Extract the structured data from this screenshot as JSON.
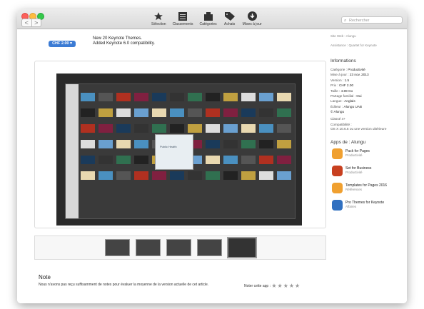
{
  "toolbar": {
    "nav_back": "<",
    "nav_forward": ">",
    "items": [
      {
        "label": "Sélection",
        "icon": "star-icon"
      },
      {
        "label": "Classements",
        "icon": "list-icon"
      },
      {
        "label": "Catégories",
        "icon": "box-icon"
      },
      {
        "label": "Achats",
        "icon": "tag-icon"
      },
      {
        "label": "Mises à jour",
        "icon": "download-icon"
      }
    ],
    "search_placeholder": "Rechercher"
  },
  "header": {
    "price": "CHF 2.00",
    "release_notes": [
      "New 20 Keynote Themes.",
      "Added Keynote 6.0 compatibility."
    ]
  },
  "sidebar": {
    "links": [
      "Site Web : Alungu",
      "Assistance : Quartet for Keynote"
    ],
    "informations_title": "Informations",
    "info": [
      {
        "label": "Catégorie :",
        "value": "Productivité"
      },
      {
        "label": "Mise à jour :",
        "value": "23 nov. 2013"
      },
      {
        "label": "Version :",
        "value": "1.5"
      },
      {
        "label": "Prix :",
        "value": "CHF 2.00"
      },
      {
        "label": "Taille :",
        "value": "4.89 Go"
      },
      {
        "label": "Partage familial :",
        "value": "Oui"
      },
      {
        "label": "Langue :",
        "value": "Anglais"
      },
      {
        "label": "Éditeur :",
        "value": "Alungu UAB"
      },
      {
        "label": "",
        "value": "© Alungu"
      }
    ],
    "rating": "Classé 4+",
    "compat_label": "Compatibilité :",
    "compat_value": "OS X 10.6.6 ou une version ultérieure",
    "apps_title": "Apps de : Alungu",
    "apps": [
      {
        "name": "Pack for Pages",
        "category": "Productivité",
        "color": "#f0a030"
      },
      {
        "name": "Set for Business",
        "category": "Productivité",
        "color": "#c84020"
      },
      {
        "name": "Templates for Pages 2016",
        "category": "Références",
        "color": "#f0a030"
      },
      {
        "name": "Pro Themes for Keynote",
        "category": "Affaires",
        "color": "#3070c0"
      }
    ]
  },
  "note": {
    "title": "Note",
    "text": "Nous n'avons pas reçu suffisamment de notes pour évaluer la moyenne de la version actuelle de cet article.",
    "rate_label": "Noter cette app :",
    "stars": "★★★★★"
  },
  "dialog_text": "Public Health"
}
